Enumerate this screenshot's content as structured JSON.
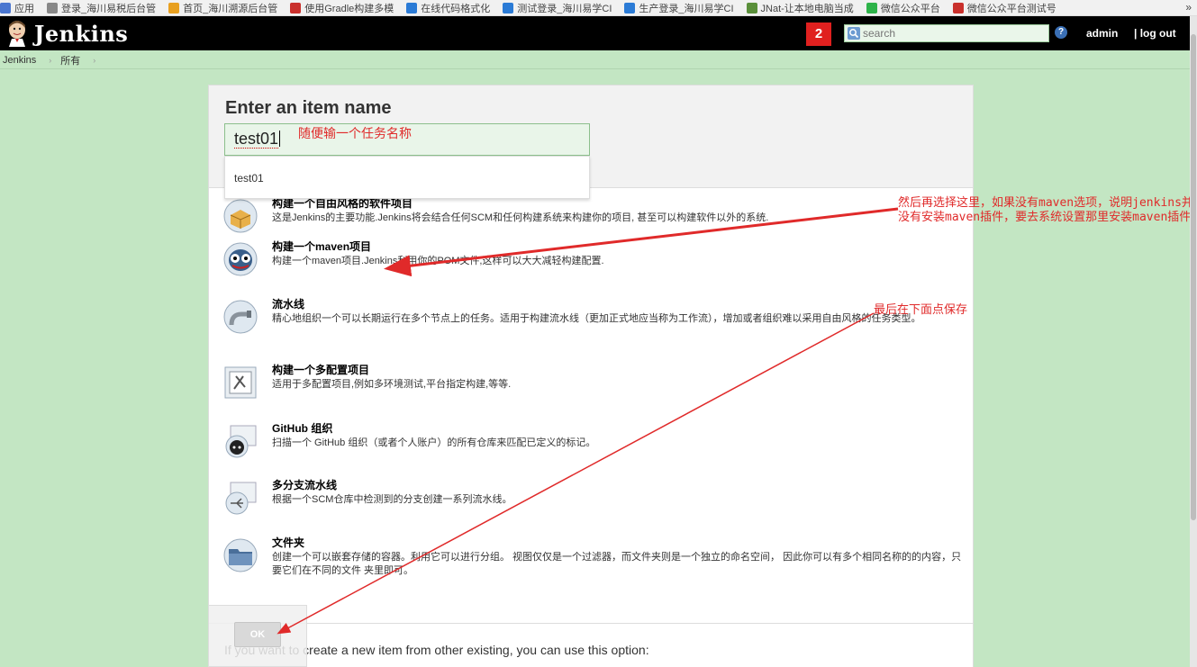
{
  "bookmarks": {
    "items": [
      {
        "label": "应用",
        "icon": "apps-icon",
        "color": "#4a76d0"
      },
      {
        "label": "登录_海川易税后台管",
        "icon": "page-icon",
        "color": "#888888"
      },
      {
        "label": "首页_海川溯源后台管",
        "icon": "leaf-icon",
        "color": "#e8a020"
      },
      {
        "label": "使用Gradle构建多模",
        "icon": "csdn-icon",
        "color": "#c9302c"
      },
      {
        "label": "在线代码格式化",
        "icon": "globe-icon",
        "color": "#2b7bd6"
      },
      {
        "label": "测试登录_海川易学CI",
        "icon": "site-icon",
        "color": "#2b7bd6"
      },
      {
        "label": "生产登录_海川易学CI",
        "icon": "site-icon",
        "color": "#2b7bd6"
      },
      {
        "label": "JNat-让本地电脑当成",
        "icon": "nat-icon",
        "color": "#5a8f3a"
      },
      {
        "label": "微信公众平台",
        "icon": "wechat-icon",
        "color": "#2eb34a"
      },
      {
        "label": "微信公众平台测试号",
        "icon": "csdn-icon",
        "color": "#c9302c"
      }
    ],
    "more": "»"
  },
  "header": {
    "logo_text": "Jenkins",
    "notification_count": "2",
    "search_placeholder": "search",
    "help": "?",
    "user": "admin",
    "logout": "| log out"
  },
  "breadcrumb": [
    "Jenkins",
    "所有"
  ],
  "form": {
    "title": "Enter an item name",
    "item_name": "test01",
    "autocomplete": "test01",
    "annotation": "随便输一个任务名称"
  },
  "item_types": [
    {
      "title": "构建一个自由风格的软件项目",
      "desc": "这是Jenkins的主要功能.Jenkins将会结合任何SCM和任何构建系统来构建你的项目, 甚至可以构建软件以外的系统.",
      "icon": "freestyle-box-icon"
    },
    {
      "title": "构建一个maven项目",
      "desc": "构建一个maven项目.Jenkins利用你的POM文件,这样可以大大减轻构建配置.",
      "icon": "maven-owl-icon"
    },
    {
      "title": "流水线",
      "desc": "精心地组织一个可以长期运行在多个节点上的任务。适用于构建流水线（更加正式地应当称为工作流），增加或者组织难以采用自由风格的任务类型。",
      "icon": "pipeline-icon"
    },
    {
      "title": "构建一个多配置项目",
      "desc": "适用于多配置项目,例如多环境测试,平台指定构建,等等.",
      "icon": "multi-config-icon"
    },
    {
      "title": "GitHub 组织",
      "desc": "扫描一个 GitHub 组织（或者个人账户）的所有仓库来匹配已定义的标记。",
      "icon": "github-org-icon"
    },
    {
      "title": "多分支流水线",
      "desc": "根据一个SCM仓库中检测到的分支创建一系列流水线。",
      "icon": "multibranch-icon"
    },
    {
      "title": "文件夹",
      "desc": "创建一个可以嵌套存储的容器。利用它可以进行分组。 视图仅仅是一个过滤器，而文件夹则是一个独立的命名空间， 因此你可以有多个相同名称的的内容，只要它们在不同的文件 夹里即可。",
      "icon": "folder-icon"
    }
  ],
  "copy_option": "If you want to create a new item from other existing, you can use this option:",
  "ok_label": "OK",
  "annotations": {
    "maven_note": "然后再选择这里，如果没有maven选项，说明jenkins并没有安装maven插件，要去系统设置那里安装maven插件",
    "save_note": "最后在下面点保存"
  },
  "colors": {
    "page_bg": "#c3e6c3",
    "header_bg": "#000000",
    "badge": "#e0201f",
    "annotation": "#e02a2a"
  }
}
